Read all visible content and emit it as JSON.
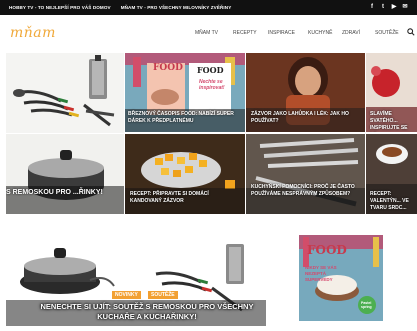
{
  "topbar": {
    "links": [
      "HOBBY TV - TO NEJLEPŠÍ PRO VÁŠ DOMOV",
      "MŇAM TV - PRO VŠECHNY MILOVNÍKY ZVĚŘINY"
    ],
    "social_icons": [
      "facebook-icon",
      "twitter-icon",
      "youtube-icon",
      "email-icon"
    ]
  },
  "navbar": {
    "logo": "mňam",
    "items": [
      "MŇAM TV",
      "RECEPTY",
      "INSPIRACE",
      "KUCHYNĚ",
      "ZDRAVÍ",
      "SOUTĚŽE"
    ],
    "search_icon": "search-icon"
  },
  "tiles": [
    {
      "caption": ""
    },
    {
      "caption": "BŘEZNOVÝ ČASOPIS FOOD: NABÍZÍ SUPER DÁREK K PŘEDPLATNÉMU",
      "cover_food": "FOOD",
      "cover_text": "Nechte se inspirovat!"
    },
    {
      "caption": "ZÁZVOR JAKO LAHŮDKA I LÉK: JAK HO POUŽÍVAT?"
    },
    {
      "caption": "SLAVÍME SVATÉHO... INSPIRUJTE SE LA..."
    },
    {
      "caption": "S REMOSKOU PRO ...ŘINKY!"
    },
    {
      "caption": "RECEPT: PŘIPRAVTE SI DOMÁCÍ KANDOVANÝ ZÁZVOR"
    },
    {
      "caption": "KUCHYŇSKÍ POMOCNÍCI: PROČ JE ČASTO POUŽÍVÁME NESPRÁVNÝM ZPŮSOBEM?"
    },
    {
      "caption": "RECEPT: VALENTÝN... VE TVARU SRDC..."
    }
  ],
  "feature": {
    "tags": [
      "NOVINKY",
      "SOUTĚŽE"
    ],
    "title": "NENECHTE SI UJÍT: SOUTĚŽ S REMOSKOU PRO VŠECHNY KUCHAŘE A KUCHAŘINKY!"
  },
  "magazine": {
    "cover_title": "FOOD",
    "cover_subtitle": "NIKDY SE VÁS NEZEPTÁ supervédy",
    "badge": "Pastel spring"
  },
  "colors": {
    "accent": "#f0a93a",
    "topbar": "#111111",
    "tag_novinky": "#f2a032",
    "tag_souteze": "#f2a032"
  }
}
